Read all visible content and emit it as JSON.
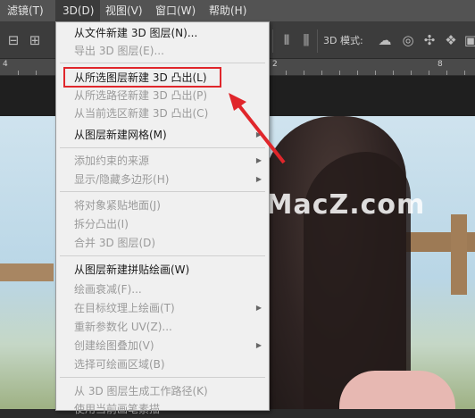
{
  "menubar": {
    "items": [
      {
        "label": "滤镜(T)"
      },
      {
        "label": "3D(D)"
      },
      {
        "label": "视图(V)"
      },
      {
        "label": "窗口(W)"
      },
      {
        "label": "帮助(H)"
      }
    ]
  },
  "options": {
    "mode_label": "3D 模式:"
  },
  "ruler": {
    "labels": [
      "4",
      "2",
      "8"
    ]
  },
  "watermark": {
    "logo": "Z",
    "text": "www.MacZ.com"
  },
  "menu": {
    "items": [
      {
        "label": "从文件新建 3D 图层(N)...",
        "enabled": true
      },
      {
        "label": "导出 3D 图层(E)...",
        "enabled": false
      },
      {
        "label": "从所选图层新建 3D 凸出(L)",
        "enabled": true
      },
      {
        "label": "从所选路径新建 3D 凸出(P)",
        "enabled": false
      },
      {
        "label": "从当前选区新建 3D 凸出(C)",
        "enabled": false
      },
      {
        "label": "从图层新建网格(M)",
        "enabled": true,
        "submenu": true
      },
      {
        "label": "添加约束的来源",
        "enabled": false,
        "submenu": true
      },
      {
        "label": "显示/隐藏多边形(H)",
        "enabled": false,
        "submenu": true
      },
      {
        "label": "将对象紧贴地面(J)",
        "enabled": false
      },
      {
        "label": "拆分凸出(I)",
        "enabled": false
      },
      {
        "label": "合并 3D 图层(D)",
        "enabled": false
      },
      {
        "label": "从图层新建拼贴绘画(W)",
        "enabled": true
      },
      {
        "label": "绘画衰减(F)...",
        "enabled": false
      },
      {
        "label": "在目标纹理上绘画(T)",
        "enabled": false,
        "submenu": true
      },
      {
        "label": "重新参数化 UV(Z)...",
        "enabled": false
      },
      {
        "label": "创建绘图叠加(V)",
        "enabled": false,
        "submenu": true
      },
      {
        "label": "选择可绘画区域(B)",
        "enabled": false
      },
      {
        "label": "从 3D 图层生成工作路径(K)",
        "enabled": false
      },
      {
        "label": "使用当前画笔素描",
        "enabled": false
      }
    ]
  },
  "colors": {
    "highlight": "#e0262b",
    "menu_bg": "#f0f0f0",
    "menubar_bg": "#535353"
  }
}
